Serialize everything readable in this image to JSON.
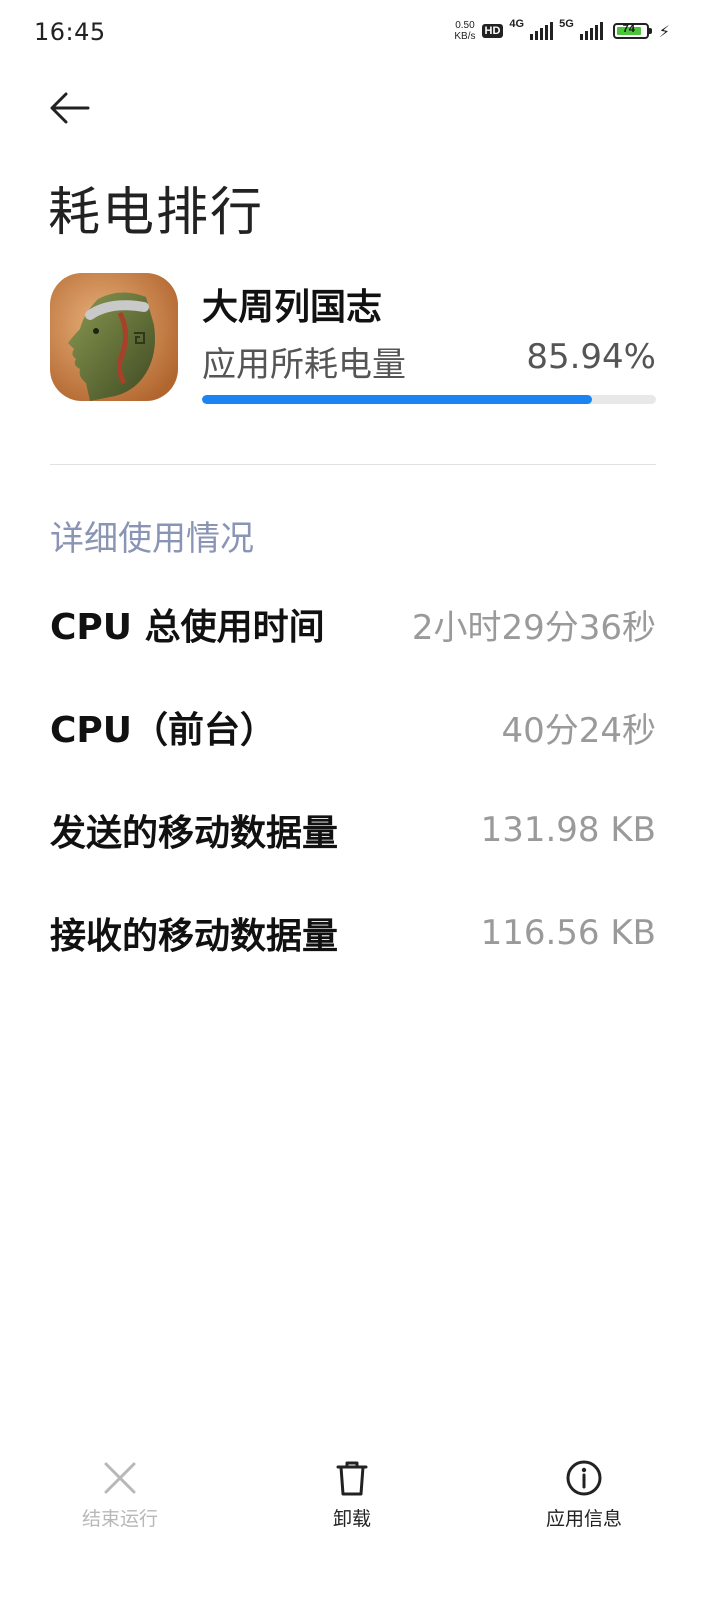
{
  "status_bar": {
    "time": "16:45",
    "net_speed_value": "0.50",
    "net_speed_unit": "KB/s",
    "hd_badge": "HD",
    "network_1": "4G",
    "network_2": "5G",
    "battery_level": "74",
    "battery_color": "#4cc43a"
  },
  "header": {
    "back_icon": "arrow-left-icon",
    "title": "耗电排行"
  },
  "app": {
    "name": "大周列国志",
    "usage_label": "应用所耗电量",
    "usage_percent_text": "85.94%",
    "usage_fraction": 0.8594,
    "accent_color": "#1a84f2"
  },
  "details": {
    "section_title": "详细使用情况",
    "rows": [
      {
        "label": "CPU 总使用时间",
        "value": "2小时29分36秒"
      },
      {
        "label": "CPU（前台）",
        "value": "40分24秒"
      },
      {
        "label": "发送的移动数据量",
        "value": "131.98 KB"
      },
      {
        "label": "接收的移动数据量",
        "value": "116.56 KB"
      }
    ]
  },
  "bottom_actions": [
    {
      "icon": "close-icon",
      "label": "结束运行",
      "enabled": false
    },
    {
      "icon": "trash-icon",
      "label": "卸载",
      "enabled": true
    },
    {
      "icon": "info-icon",
      "label": "应用信息",
      "enabled": true
    }
  ]
}
